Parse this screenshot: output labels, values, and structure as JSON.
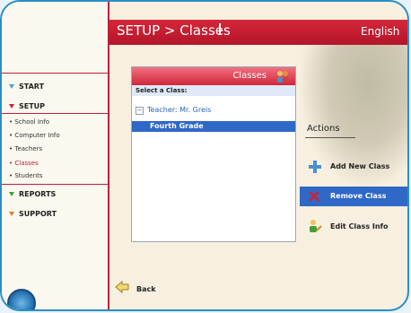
{
  "header": {
    "title": "SETUP > Classes",
    "language": "English"
  },
  "sidebar": {
    "start": "START",
    "setup": "SETUP",
    "setup_items": [
      "School Info",
      "Computer Info",
      "Teachers",
      "Classes",
      "Students"
    ],
    "active_item": "Classes",
    "reports": "REPORTS",
    "support": "SUPPORT"
  },
  "panel": {
    "title": "Classes",
    "subtitle": "Select a Class:",
    "teacher_row": "Teacher: Mr. Greis",
    "class_row": "Fourth Grade"
  },
  "actions": {
    "title": "Actions",
    "items": [
      "Add New Class",
      "Remove Class",
      "Edit Class Info"
    ]
  },
  "footer": {
    "back": "Back"
  },
  "colors": {
    "accent_red": "#c0203a",
    "selection_blue": "#2f68c7",
    "frame_blue": "#2a8ec4"
  }
}
